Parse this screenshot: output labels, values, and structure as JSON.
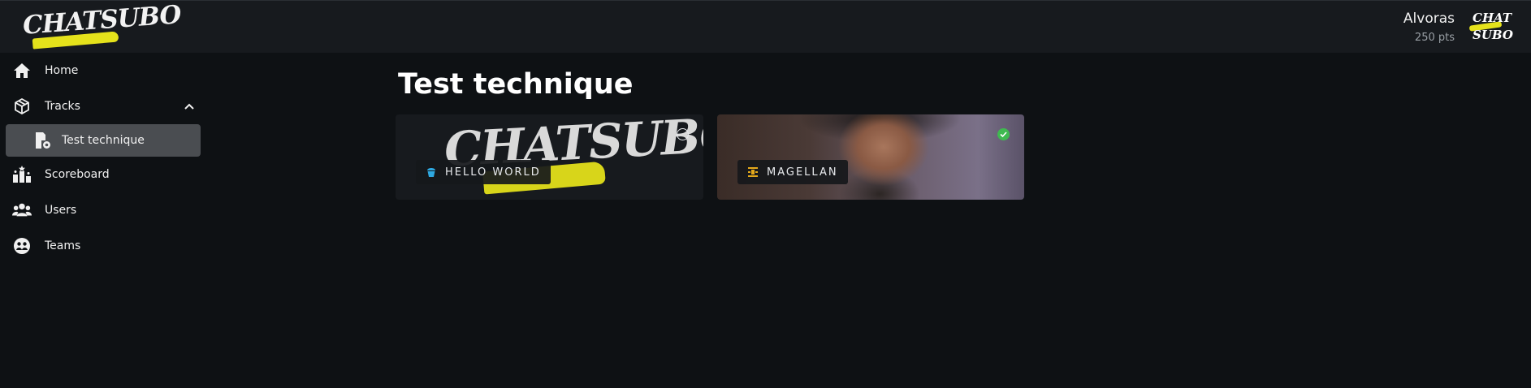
{
  "app": {
    "brand": "CHATSUBO"
  },
  "user": {
    "name": "Alvoras",
    "points": "250 pts",
    "avatar_line1": "CHAT",
    "avatar_line2": "SUBO"
  },
  "sidebar": {
    "items": [
      {
        "label": "Home",
        "icon": "home-icon"
      },
      {
        "label": "Tracks",
        "icon": "cube-icon",
        "expanded": true
      },
      {
        "label": "Scoreboard",
        "icon": "podium-icon"
      },
      {
        "label": "Users",
        "icon": "users-icon"
      },
      {
        "label": "Teams",
        "icon": "team-icon"
      }
    ],
    "sub_items": [
      {
        "label": "Test technique",
        "icon": "settings-doc-icon",
        "active": true
      }
    ]
  },
  "main": {
    "title": "Test technique",
    "cards": [
      {
        "label": "HELLO WORLD",
        "icon": "cupcake-icon",
        "icon_color": "#2ea8e0",
        "status": "open",
        "background_text": "CHATSUBO"
      },
      {
        "label": "MAGELLAN",
        "icon": "compass-icon",
        "icon_color": "#e5a91b",
        "status": "completed"
      }
    ]
  },
  "colors": {
    "accent": "#e5e21b",
    "completed": "#3fb950",
    "active_item": "#4a4d51"
  }
}
